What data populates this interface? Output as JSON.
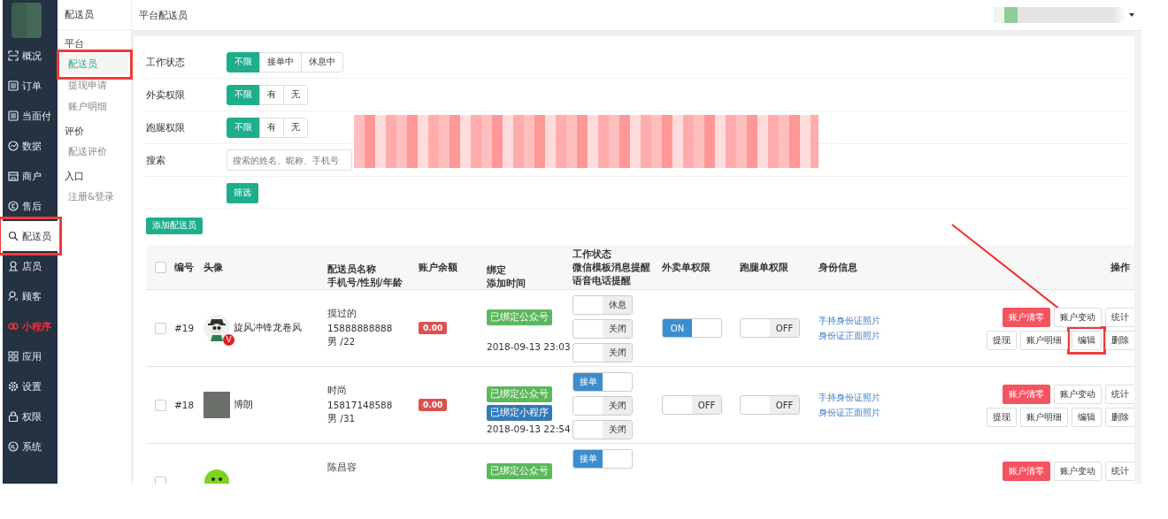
{
  "sidebar": {
    "items": [
      {
        "label": "概况",
        "kind": "overview",
        "selected": false,
        "accent": false,
        "marked": false
      },
      {
        "label": "订单",
        "kind": "doc",
        "selected": false,
        "accent": false,
        "marked": false
      },
      {
        "label": "当面付",
        "kind": "doc",
        "selected": false,
        "accent": false,
        "marked": false
      },
      {
        "label": "数据",
        "kind": "chart",
        "selected": false,
        "accent": false,
        "marked": false
      },
      {
        "label": "商户",
        "kind": "shop",
        "selected": false,
        "accent": false,
        "marked": false
      },
      {
        "label": "售后",
        "kind": "service",
        "selected": false,
        "accent": false,
        "marked": false
      },
      {
        "label": "配送员",
        "kind": "search",
        "selected": true,
        "accent": false,
        "marked": true
      },
      {
        "label": "店员",
        "kind": "person",
        "selected": false,
        "accent": false,
        "marked": false
      },
      {
        "label": "顾客",
        "kind": "people",
        "selected": false,
        "accent": false,
        "marked": false
      },
      {
        "label": "小程序",
        "kind": "miniapp",
        "selected": false,
        "accent": true,
        "marked": false
      },
      {
        "label": "应用",
        "kind": "apps",
        "selected": false,
        "accent": false,
        "marked": false
      },
      {
        "label": "设置",
        "kind": "gear",
        "selected": false,
        "accent": false,
        "marked": false
      },
      {
        "label": "权限",
        "kind": "lock",
        "selected": false,
        "accent": false,
        "marked": false
      },
      {
        "label": "系统",
        "kind": "system",
        "selected": false,
        "accent": false,
        "marked": false
      }
    ]
  },
  "submenu": {
    "title": "配送员",
    "groups": [
      {
        "heading": "平台",
        "items": [
          {
            "label": "配送员",
            "selected": true,
            "marked": true
          },
          {
            "label": "提现申请",
            "selected": false,
            "marked": false
          },
          {
            "label": "账户明细",
            "selected": false,
            "marked": false
          }
        ]
      },
      {
        "heading": "评价",
        "items": [
          {
            "label": "配送评价",
            "selected": false,
            "marked": false
          }
        ]
      },
      {
        "heading": "入口",
        "items": [
          {
            "label": "注册&登录",
            "selected": false,
            "marked": false
          }
        ]
      }
    ]
  },
  "header": {
    "title": "平台配送员"
  },
  "filters": [
    {
      "label": "工作状态",
      "options": [
        {
          "label": "不限",
          "selected": true
        },
        {
          "label": "接单中",
          "selected": false
        },
        {
          "label": "休息中",
          "selected": false
        }
      ]
    },
    {
      "label": "外卖权限",
      "options": [
        {
          "label": "不限",
          "selected": true
        },
        {
          "label": "有",
          "selected": false
        },
        {
          "label": "无",
          "selected": false
        }
      ]
    },
    {
      "label": "跑腿权限",
      "options": [
        {
          "label": "不限",
          "selected": true
        },
        {
          "label": "有",
          "selected": false
        },
        {
          "label": "无",
          "selected": false
        }
      ]
    }
  ],
  "search": {
    "label": "搜索",
    "placeholder": "搜索的姓名、昵称、手机号"
  },
  "filter_button": "筛选",
  "add_button": "添加配送员",
  "arrow_to_marked_button": true,
  "table": {
    "all_checked": false,
    "columns": [
      [
        "编号"
      ],
      [
        "头像"
      ],
      [
        "配送员名称",
        "手机号/性别/年龄"
      ],
      [
        "账户余额"
      ],
      [
        "绑定",
        "添加时间"
      ],
      [
        "工作状态",
        "微信模板消息提醒",
        "语音电话提醒"
      ],
      [
        "外卖单权限"
      ],
      [
        "跑腿单权限"
      ],
      [
        "身份信息"
      ],
      [
        "操作"
      ]
    ],
    "rows": [
      {
        "checked": false,
        "id": "#19",
        "avatar": {
          "kind": "cartoon",
          "badge": "V"
        },
        "nickname": "旋风冲锋龙卷风",
        "name": "摸过的",
        "phone": "15888888888",
        "gender_age": "男 /22",
        "balance": "0.00",
        "bindings": [
          {
            "label": "已绑定公众号",
            "kind": "wechat"
          }
        ],
        "time": "2018-09-13 23:03",
        "toggles": [
          {
            "text": "休息",
            "on": false
          },
          {
            "text": "关闭",
            "on": false
          },
          {
            "text": "关闭",
            "on": false
          }
        ],
        "waimai": {
          "text": "ON",
          "on": true
        },
        "paotui": {
          "text": "OFF",
          "on": false
        },
        "links": [
          "手持身份证照片",
          "身份证正面照片"
        ],
        "actions": [
          [
            {
              "label": "账户清零",
              "kind": "danger",
              "marked": false
            },
            {
              "label": "账户变动",
              "kind": "default",
              "marked": false
            },
            {
              "label": "统计",
              "kind": "default",
              "marked": false
            }
          ],
          [
            {
              "label": "提现",
              "kind": "default",
              "marked": false
            },
            {
              "label": "账户明细",
              "kind": "default",
              "marked": false
            },
            {
              "label": "编辑",
              "kind": "default",
              "marked": true
            },
            {
              "label": "删除",
              "kind": "default",
              "marked": false
            }
          ]
        ]
      },
      {
        "checked": false,
        "id": "#18",
        "avatar": {
          "kind": "photo"
        },
        "nickname": "博朗",
        "name": "时尚",
        "phone": "15817148588",
        "gender_age": "男 /31",
        "balance": "0.00",
        "bindings": [
          {
            "label": "已绑定公众号",
            "kind": "wechat"
          },
          {
            "label": "已绑定小程序",
            "kind": "miniapp"
          }
        ],
        "time": "2018-09-13 22:54",
        "toggles": [
          {
            "text": "接单",
            "on": true
          },
          {
            "text": "关闭",
            "on": false
          },
          {
            "text": "关闭",
            "on": false
          }
        ],
        "waimai": {
          "text": "OFF",
          "on": false
        },
        "paotui": {
          "text": "OFF",
          "on": false
        },
        "links": [
          "手持身份证照片",
          "身份证正面照片"
        ],
        "actions": [
          [
            {
              "label": "账户清零",
              "kind": "danger",
              "marked": false
            },
            {
              "label": "账户变动",
              "kind": "default",
              "marked": false
            },
            {
              "label": "统计",
              "kind": "default",
              "marked": false
            }
          ],
          [
            {
              "label": "提现",
              "kind": "default",
              "marked": false
            },
            {
              "label": "账户明细",
              "kind": "default",
              "marked": false
            },
            {
              "label": "编辑",
              "kind": "default",
              "marked": false
            },
            {
              "label": "删除",
              "kind": "default",
              "marked": false
            }
          ]
        ]
      },
      {
        "checked": false,
        "avatar": {
          "kind": "smiley"
        },
        "name": "陈昌容",
        "bindings": [
          {
            "label": "已绑定公众号",
            "kind": "wechat"
          }
        ],
        "toggles": [
          {
            "text": "接单",
            "on": true
          }
        ],
        "actions": [
          [
            {
              "label": "账户清零",
              "kind": "danger",
              "marked": false
            },
            {
              "label": "账户变动",
              "kind": "default",
              "marked": false
            },
            {
              "label": "统计",
              "kind": "default",
              "marked": false
            }
          ]
        ]
      }
    ]
  }
}
